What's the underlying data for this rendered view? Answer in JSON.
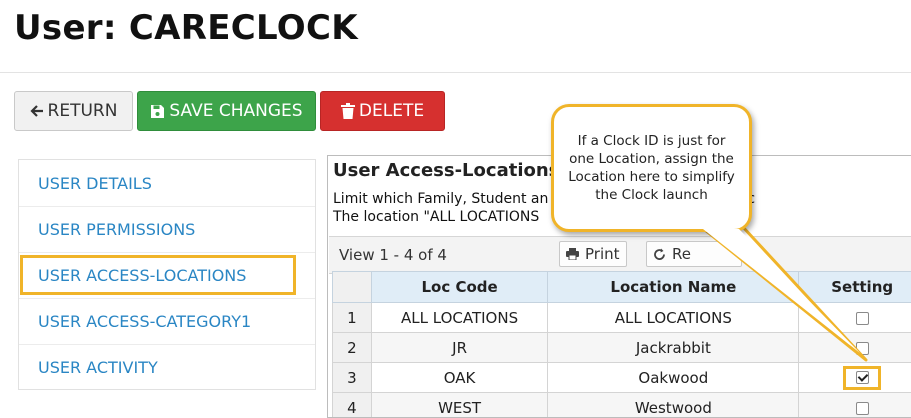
{
  "header": {
    "title": "User: CARECLOCK"
  },
  "toolbar": {
    "return_label": "RETURN",
    "save_label": "SAVE CHANGES",
    "delete_label": "DELETE"
  },
  "sidebar": {
    "items": [
      {
        "label": "USER DETAILS"
      },
      {
        "label": "USER PERMISSIONS"
      },
      {
        "label": "USER ACCESS-LOCATIONS"
      },
      {
        "label": "USER ACCESS-CATEGORY1"
      },
      {
        "label": "USER ACTIVITY"
      }
    ]
  },
  "panel": {
    "title": "User Access-Locations",
    "desc_line1": "Limit which Family, Student an          an access based on loc",
    "desc_line2": "The location \"ALL LOCATIONS          s. This does not apply t",
    "view_count": "View 1 - 4 of 4",
    "print_label": "Print",
    "refresh_label": "Re"
  },
  "table": {
    "headers": {
      "loc_code": "Loc Code",
      "location_name": "Location Name",
      "setting": "Setting"
    },
    "rows": [
      {
        "n": "1",
        "loc_code": "ALL LOCATIONS",
        "location_name": "ALL LOCATIONS",
        "checked": false
      },
      {
        "n": "2",
        "loc_code": "JR",
        "location_name": "Jackrabbit",
        "checked": false
      },
      {
        "n": "3",
        "loc_code": "OAK",
        "location_name": "Oakwood",
        "checked": true
      },
      {
        "n": "4",
        "loc_code": "WEST",
        "location_name": "Westwood",
        "checked": false
      }
    ]
  },
  "callout": {
    "text": "If a Clock ID is just for one Location, assign the Location here to simplify the Clock launch"
  },
  "colors": {
    "highlight": "#f0b429",
    "save": "#3da44a",
    "delete": "#d6302f",
    "link": "#2a86c4",
    "grid_header": "#e0edf7"
  },
  "icons": {
    "return": "arrow-left-icon",
    "save": "floppy-disk-icon",
    "delete": "trash-icon",
    "print": "printer-icon",
    "refresh": "refresh-icon"
  }
}
